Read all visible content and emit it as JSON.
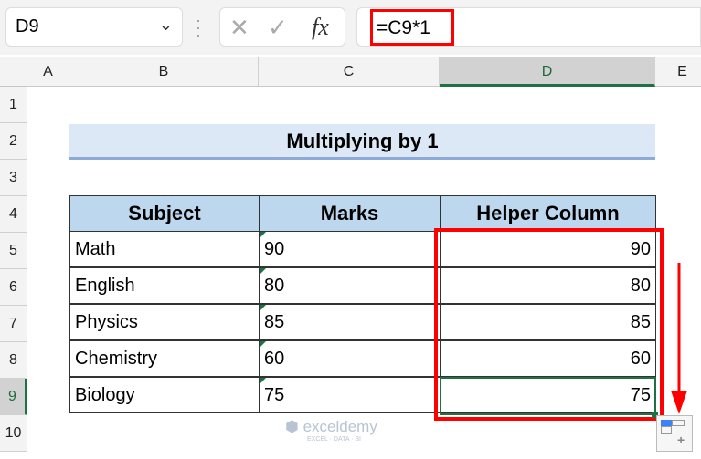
{
  "name_box": "D9",
  "formula": "=C9*1",
  "columns": [
    "A",
    "B",
    "C",
    "D",
    "E"
  ],
  "rows": [
    "1",
    "2",
    "3",
    "4",
    "5",
    "6",
    "7",
    "8",
    "9",
    "10"
  ],
  "title": "Multiplying by 1",
  "headers": [
    "Subject",
    "Marks",
    "Helper Column"
  ],
  "data": [
    [
      "Math",
      "90",
      "90"
    ],
    [
      "English",
      "80",
      "80"
    ],
    [
      "Physics",
      "85",
      "85"
    ],
    [
      "Chemistry",
      "60",
      "60"
    ],
    [
      "Biology",
      "75",
      "75"
    ]
  ],
  "watermark": "exceldemy",
  "watermark_sub": "EXCEL · DATA · BI",
  "colors": {
    "highlight": "#ff0000",
    "selection": "#1e7145",
    "header_fill": "#bdd7ee"
  }
}
